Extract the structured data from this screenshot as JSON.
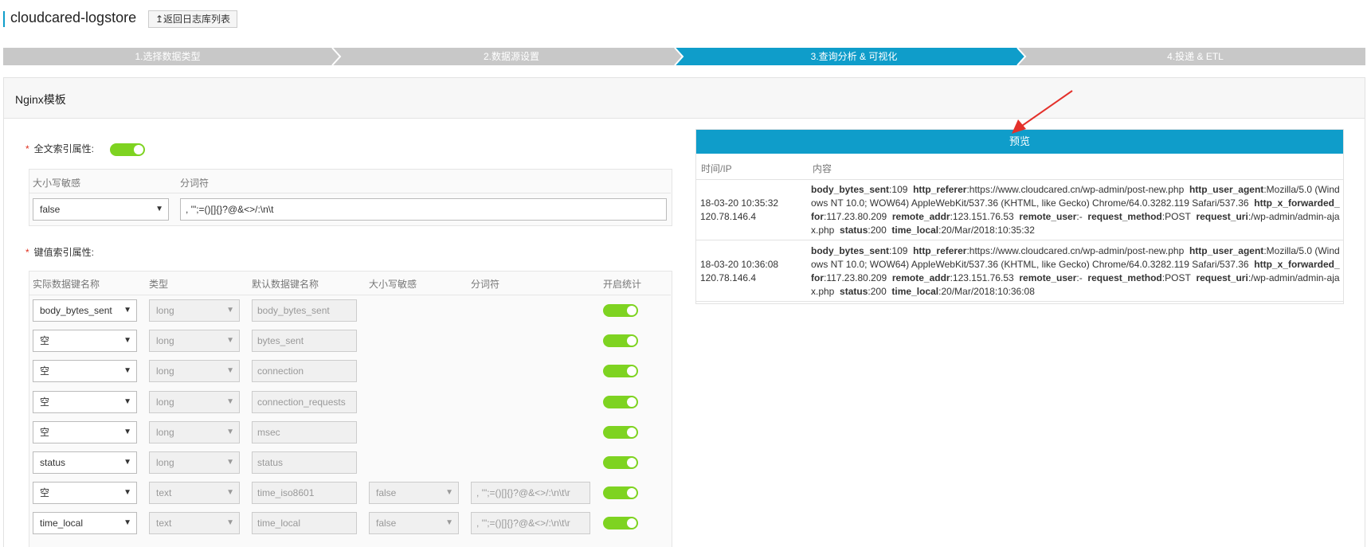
{
  "header": {
    "title": "cloudcared-logstore",
    "back_label": "↥返回日志库列表"
  },
  "steps": [
    {
      "label": "1.选择数据类型",
      "active": false
    },
    {
      "label": "2.数据源设置",
      "active": false
    },
    {
      "label": "3.查询分析 & 可视化",
      "active": true
    },
    {
      "label": "4.投递 & ETL",
      "active": false
    }
  ],
  "colors": {
    "accent": "#0f9dca",
    "step_inactive": "#c8c8c8",
    "toggle_on": "#7ed321",
    "required": "#e0301e",
    "arrow": "#e4312b"
  },
  "panel": {
    "title": "Nginx模板"
  },
  "fulltext": {
    "label": "全文索引属性:",
    "enabled": true,
    "col_case": "大小写敏感",
    "col_token": "分词符",
    "case_value": "false",
    "token_value": ", '\";=()[]{}?@&<>/:\\n\\t"
  },
  "keyindex": {
    "label": "键值索引属性:",
    "columns": [
      "实际数据键名称",
      "类型",
      "默认数据键名称",
      "大小写敏感",
      "分词符",
      "开启统计"
    ],
    "rows": [
      {
        "key": "body_bytes_sent",
        "type": "long",
        "default_key": "body_bytes_sent",
        "case": "",
        "token": "",
        "stat": true
      },
      {
        "key": "空",
        "type": "long",
        "default_key": "bytes_sent",
        "case": "",
        "token": "",
        "stat": true
      },
      {
        "key": "空",
        "type": "long",
        "default_key": "connection",
        "case": "",
        "token": "",
        "stat": true
      },
      {
        "key": "空",
        "type": "long",
        "default_key": "connection_requests",
        "case": "",
        "token": "",
        "stat": true
      },
      {
        "key": "空",
        "type": "long",
        "default_key": "msec",
        "case": "",
        "token": "",
        "stat": true
      },
      {
        "key": "status",
        "type": "long",
        "default_key": "status",
        "case": "",
        "token": "",
        "stat": true
      },
      {
        "key": "空",
        "type": "text",
        "default_key": "time_iso8601",
        "case": "false",
        "token": ", '\";=()[]{}?@&<>/:\\n\\t\\r",
        "stat": true
      },
      {
        "key": "time_local",
        "type": "text",
        "default_key": "time_local",
        "case": "false",
        "token": ", '\";=()[]{}?@&<>/:\\n\\t\\r",
        "stat": true
      }
    ]
  },
  "preview": {
    "title": "预览",
    "col_time": "时间/IP",
    "col_content": "内容",
    "rows": [
      {
        "time": "18-03-20 10:35:32",
        "ip": "120.78.146.4",
        "fields": [
          {
            "k": "body_bytes_sent",
            "v": "109"
          },
          {
            "k": "http_referer",
            "v": "https://www.cloudcared.cn/wp-admin/post-new.php"
          },
          {
            "k": "http_user_agent",
            "v": "Mozilla/5.0 (Windows NT 10.0; WOW64) AppleWebKit/537.36 (KHTML, like Gecko) Chrome/64.0.3282.119 Safari/537.36"
          },
          {
            "k": "http_x_forwarded_for",
            "v": "117.23.80.209"
          },
          {
            "k": "remote_addr",
            "v": "123.151.76.53"
          },
          {
            "k": "remote_user",
            "v": "-"
          },
          {
            "k": "request_method",
            "v": "POST"
          },
          {
            "k": "request_uri",
            "v": "/wp-admin/admin-ajax.php"
          },
          {
            "k": "status",
            "v": "200"
          },
          {
            "k": "time_local",
            "v": "20/Mar/2018:10:35:32"
          }
        ]
      },
      {
        "time": "18-03-20 10:36:08",
        "ip": "120.78.146.4",
        "fields": [
          {
            "k": "body_bytes_sent",
            "v": "109"
          },
          {
            "k": "http_referer",
            "v": "https://www.cloudcared.cn/wp-admin/post-new.php"
          },
          {
            "k": "http_user_agent",
            "v": "Mozilla/5.0 (Windows NT 10.0; WOW64) AppleWebKit/537.36 (KHTML, like Gecko) Chrome/64.0.3282.119 Safari/537.36"
          },
          {
            "k": "http_x_forwarded_for",
            "v": "117.23.80.209"
          },
          {
            "k": "remote_addr",
            "v": "123.151.76.53"
          },
          {
            "k": "remote_user",
            "v": "-"
          },
          {
            "k": "request_method",
            "v": "POST"
          },
          {
            "k": "request_uri",
            "v": "/wp-admin/admin-ajax.php"
          },
          {
            "k": "status",
            "v": "200"
          },
          {
            "k": "time_local",
            "v": "20/Mar/2018:10:36:08"
          }
        ]
      }
    ]
  }
}
